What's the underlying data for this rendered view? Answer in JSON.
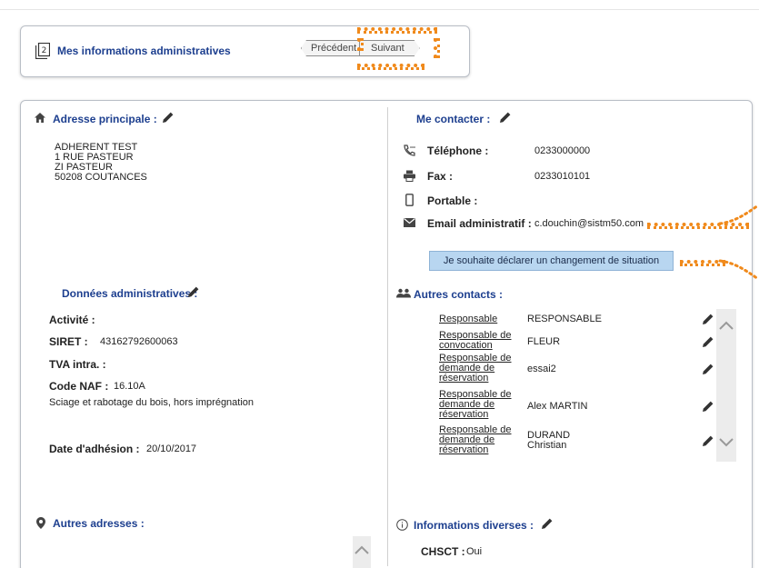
{
  "header": {
    "step_number": "2",
    "title": "Mes informations administratives",
    "prev_label": "Précédent",
    "next_label": "Suivant",
    "accent_color": "#f08a1c",
    "title_color": "#1d3f8f"
  },
  "address": {
    "title": "Adresse principale :",
    "lines": [
      "ADHERENT TEST",
      "1 RUE PASTEUR",
      "ZI PASTEUR",
      "50208 COUTANCES"
    ]
  },
  "admin": {
    "title": "Données administratives :",
    "activite_label": "Activité :",
    "activite_value": "",
    "siret_label": "SIRET :",
    "siret_value": "43162792600063",
    "tva_label": "TVA intra. :",
    "tva_value": "",
    "naf_label": "Code NAF :",
    "naf_value": "16.10A",
    "naf_desc": "Sciage et rabotage du bois, hors imprégnation",
    "adhesion_label": "Date d'adhésion :",
    "adhesion_value": "20/10/2017"
  },
  "other_addresses": {
    "title": "Autres adresses :"
  },
  "contact": {
    "title": "Me contacter :",
    "phone_label": "Téléphone :",
    "phone_value": "0233000000",
    "fax_label": "Fax :",
    "fax_value": "0233010101",
    "mobile_label": "Portable :",
    "mobile_value": "",
    "email_label": "Email administratif :",
    "email_value": "c.douchin@sistm50.com",
    "change_button": "Je souhaite déclarer un changement de situation"
  },
  "other_contacts": {
    "title": "Autres contacts :",
    "rows": [
      {
        "role": [
          "Responsable"
        ],
        "name": [
          "RESPONSABLE"
        ]
      },
      {
        "role": [
          "Responsable de",
          "convocation"
        ],
        "name": [
          "FLEUR"
        ]
      },
      {
        "role": [
          "Responsable de",
          "demande de",
          "réservation"
        ],
        "name": [
          "essai2"
        ]
      },
      {
        "role": [
          "Responsable de",
          "demande de",
          "réservation"
        ],
        "name": [
          "Alex MARTIN"
        ]
      },
      {
        "role": [
          "Responsable de",
          "demande de",
          "réservation"
        ],
        "name": [
          "DURAND",
          "Christian"
        ]
      }
    ]
  },
  "misc": {
    "title": "Informations diverses :",
    "chsct_label": "CHSCT :",
    "chsct_value": "Oui"
  }
}
